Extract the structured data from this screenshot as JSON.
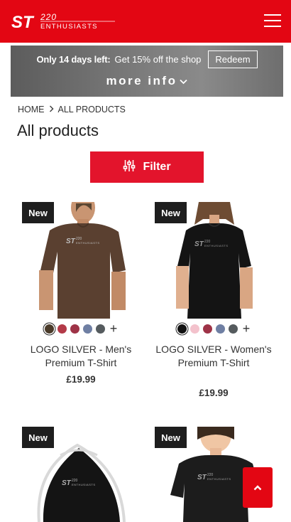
{
  "header": {
    "logo_prefix": "ST",
    "logo_number": "220",
    "logo_suffix": "ENTHUSIASTS",
    "brand_color": "#e30613",
    "menu_icon": "hamburger-icon"
  },
  "promo": {
    "bold_text": "Only 14 days left:",
    "text": "Get 15% off the shop",
    "redeem_label": "Redeem",
    "more_info_label": "more info",
    "more_info_icon": "chevron-down-icon"
  },
  "breadcrumb": {
    "home": "HOME",
    "current": "ALL PRODUCTS",
    "separator_icon": "chevron-right-icon"
  },
  "page": {
    "title": "All products"
  },
  "filter": {
    "label": "Filter",
    "icon": "sliders-icon",
    "color": "#e3142c"
  },
  "products": [
    {
      "badge": "New",
      "name": "LOGO SILVER - Men's Premium T-Shirt",
      "price": "£19.99",
      "print_logo": "ST220 ENTHUSIASTS",
      "swatches": [
        "#4a3b2a",
        "#b33a48",
        "#9e3347",
        "#6f7fa3",
        "#555b5e"
      ],
      "more_colors": "+"
    },
    {
      "badge": "New",
      "name": "LOGO SILVER - Women's Premium T-Shirt",
      "price": "£19.99",
      "print_logo": "ST220 ENTHUSIASTS",
      "swatches": [
        "#111111",
        "#f3c2cc",
        "#9e3347",
        "#6f7fa3",
        "#555b5e"
      ],
      "more_colors": "+"
    },
    {
      "badge": "New",
      "print_logo": "ST220 ENTHUSIASTS"
    },
    {
      "badge": "New",
      "print_logo": "ST220 ENTHUSIASTS"
    }
  ],
  "back_to_top": {
    "icon": "chevron-up-icon"
  }
}
